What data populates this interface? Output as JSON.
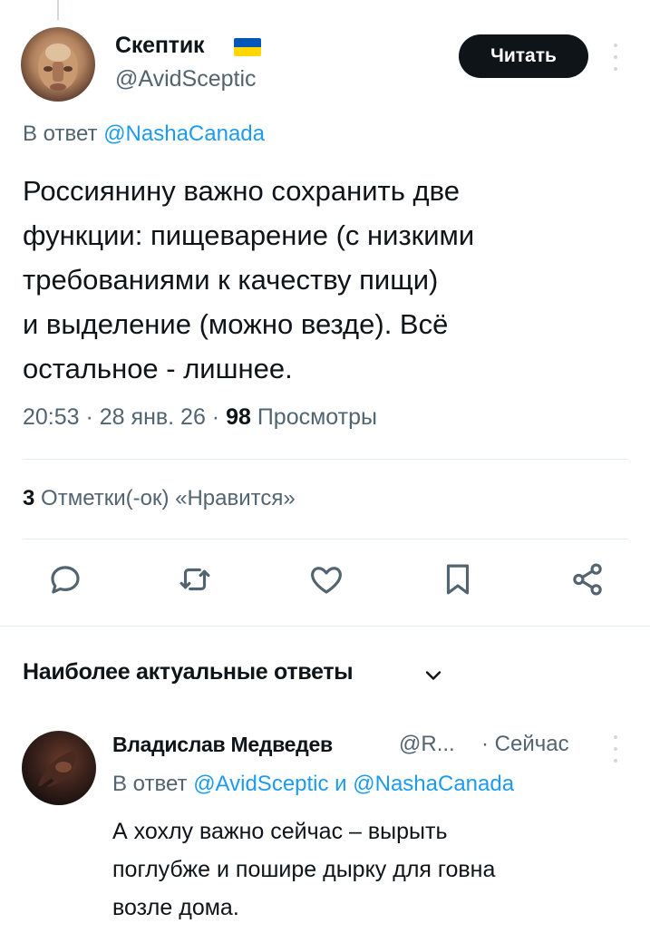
{
  "tweet": {
    "author_name": "Скептик",
    "author_handle": "@AvidSceptic",
    "read_button": "Читать",
    "reply_prefix": "В ответ",
    "reply_mention": "@NashaCanada",
    "text": "Россиянину важно сохранить две\nфункции: пищеварение (с низкими\nтребованиями к качеству пищи)\nи выделение (можно везде). Всё\nостальное - лишнее.",
    "time_date": "20:53 · 28 янв. 26 · ",
    "views_count": "98",
    "views_label": " Просмотры",
    "likes_count": "3",
    "likes_label": " Отметки(-ок) «Нравится»"
  },
  "actions": [
    {
      "icon": "reply-icon"
    },
    {
      "icon": "retweet-icon"
    },
    {
      "icon": "like-icon"
    },
    {
      "icon": "bookmark-icon"
    },
    {
      "icon": "share-icon"
    }
  ],
  "replies_section": {
    "title": "Наиболее актуальные ответы",
    "icon": "chevron-down-icon"
  },
  "reply": {
    "author_name": "Владислав Медведев",
    "author_handle": "@R...",
    "time": "· Сейчас",
    "reply_prefix": "В ответ",
    "mention1": "@AvidSceptic",
    "conjunction": " и ",
    "mention2": "@NashaCanada",
    "text": "А хохлу важно сейчас – вырыть\nпоглубже и пошире дырку для говна\nвозле дома."
  },
  "colors": {
    "accent": "#1d9bf0",
    "text": "#0f1419",
    "muted": "#536471",
    "flag_blue": "#0057b7",
    "flag_yellow": "#ffd700"
  }
}
